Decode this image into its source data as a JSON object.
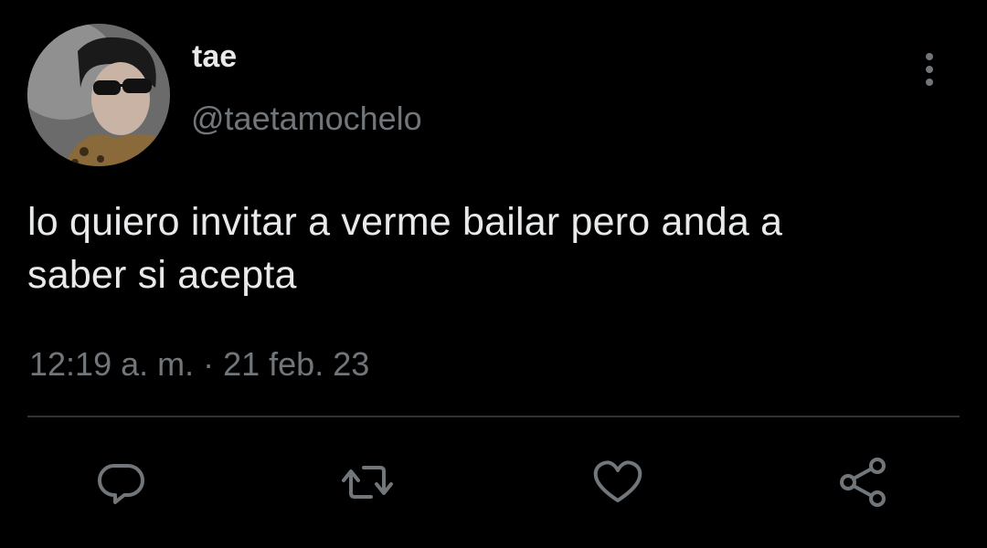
{
  "tweet": {
    "author": {
      "display_name": "tae",
      "handle": "@taetamochelo"
    },
    "text_line1": "lo quiero invitar a verme bailar pero anda a",
    "text_line2": "saber si acepta",
    "time": "12:19 a. m.",
    "separator": " · ",
    "date": "21 feb. 23"
  },
  "actions": [
    {
      "icon": "reply-icon"
    },
    {
      "icon": "retweet-icon"
    },
    {
      "icon": "like-icon"
    },
    {
      "icon": "share-icon"
    }
  ],
  "colors": {
    "background": "#000000",
    "primary_text": "#e7e9ea",
    "secondary_text": "#71767b",
    "divider": "#2f3336",
    "icon": "#71767b"
  }
}
